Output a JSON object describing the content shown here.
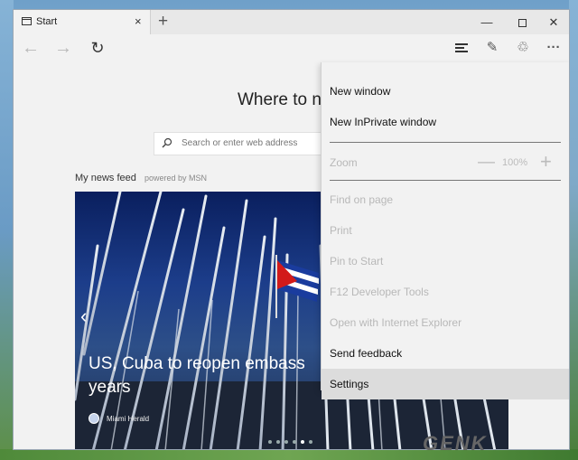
{
  "tab": {
    "title": "Start",
    "close": "×"
  },
  "titlebar": {
    "new_tab": "+",
    "minimize": "—",
    "close": "✕"
  },
  "toolbar": {
    "back": "←",
    "forward": "→",
    "refresh": "↻",
    "note": "✎",
    "share": "♲",
    "more": "···"
  },
  "page": {
    "title": "Where to ne",
    "search_placeholder": "Search or enter web address",
    "feed_label": "My news feed",
    "feed_powered": "powered by MSN"
  },
  "news": {
    "prev": "‹",
    "headline": "US, Cuba to reopen embass years",
    "source": "Miami Herald",
    "slide_count": 6,
    "active_slide": 5
  },
  "menu": {
    "items": [
      {
        "label": "New window",
        "enabled": true
      },
      {
        "label": "New InPrivate window",
        "enabled": true
      },
      {
        "label": "Zoom",
        "enabled": false
      },
      {
        "label": "Find on page",
        "enabled": false
      },
      {
        "label": "Print",
        "enabled": false
      },
      {
        "label": "Pin to Start",
        "enabled": false
      },
      {
        "label": "F12 Developer Tools",
        "enabled": false
      },
      {
        "label": "Open with Internet Explorer",
        "enabled": false
      },
      {
        "label": "Send feedback",
        "enabled": true
      },
      {
        "label": "Settings",
        "enabled": true,
        "highlighted": true
      }
    ],
    "zoom": {
      "minus": "—",
      "value": "100%",
      "plus": "+"
    }
  },
  "watermark": "GENK",
  "colors": {
    "accent": "#0078d7",
    "menu_bg": "#f2f2f2",
    "highlight": "#dcdcdc",
    "disabled": "#b8b8b8"
  }
}
